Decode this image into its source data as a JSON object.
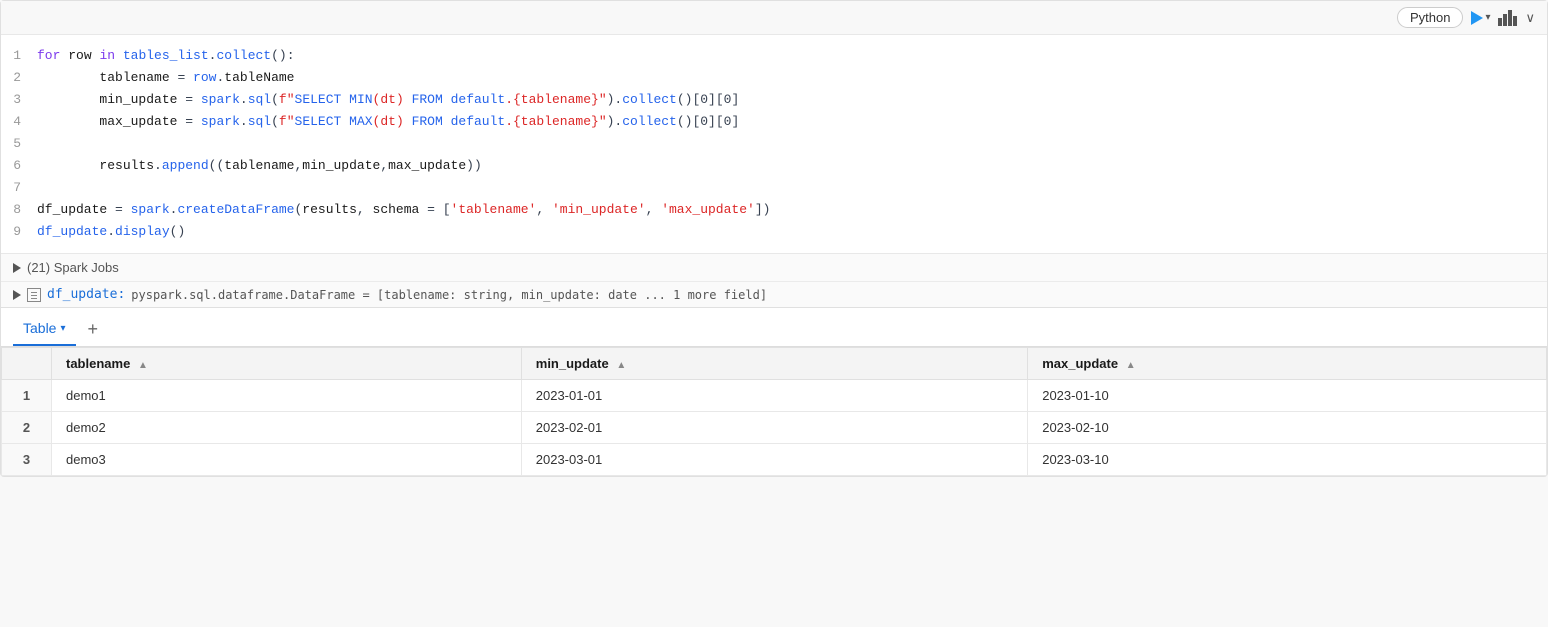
{
  "toolbar": {
    "language": "Python",
    "run_label": "Run",
    "expand_label": "∨"
  },
  "code": {
    "lines": [
      {
        "num": "1",
        "tokens": [
          {
            "t": "kw",
            "v": "for "
          },
          {
            "t": "var",
            "v": "row "
          },
          {
            "t": "kw",
            "v": "in "
          },
          {
            "t": "fn",
            "v": "tables_list"
          },
          {
            "t": "op",
            "v": "."
          },
          {
            "t": "fn",
            "v": "collect"
          },
          {
            "t": "op",
            "v": "():"
          }
        ]
      },
      {
        "num": "2",
        "tokens": [
          {
            "t": "var",
            "v": "        tablename "
          },
          {
            "t": "op",
            "v": "= "
          },
          {
            "t": "fn",
            "v": "row"
          },
          {
            "t": "op",
            "v": "."
          },
          {
            "t": "var",
            "v": "tableName"
          }
        ]
      },
      {
        "num": "3",
        "tokens": [
          {
            "t": "var",
            "v": "        min_update "
          },
          {
            "t": "op",
            "v": "= "
          },
          {
            "t": "fn",
            "v": "spark"
          },
          {
            "t": "op",
            "v": "."
          },
          {
            "t": "fn",
            "v": "sql"
          },
          {
            "t": "op",
            "v": "("
          },
          {
            "t": "fstr",
            "v": "f\"SELECT MIN(dt) FROM default.{tablename}\""
          },
          {
            "t": "op",
            "v": ")."
          },
          {
            "t": "fn",
            "v": "collect"
          },
          {
            "t": "op",
            "v": "()[0][0]"
          }
        ]
      },
      {
        "num": "4",
        "tokens": [
          {
            "t": "var",
            "v": "        max_update "
          },
          {
            "t": "op",
            "v": "= "
          },
          {
            "t": "fn",
            "v": "spark"
          },
          {
            "t": "op",
            "v": "."
          },
          {
            "t": "fn",
            "v": "sql"
          },
          {
            "t": "op",
            "v": "("
          },
          {
            "t": "fstr",
            "v": "f\"SELECT MAX(dt) FROM default.{tablename}\""
          },
          {
            "t": "op",
            "v": ")."
          },
          {
            "t": "fn",
            "v": "collect"
          },
          {
            "t": "op",
            "v": "()[0][0]"
          }
        ]
      },
      {
        "num": "5",
        "tokens": []
      },
      {
        "num": "6",
        "tokens": [
          {
            "t": "var",
            "v": "        results"
          },
          {
            "t": "op",
            "v": "."
          },
          {
            "t": "fn",
            "v": "append"
          },
          {
            "t": "op",
            "v": "(("
          },
          {
            "t": "var",
            "v": "tablename"
          },
          {
            "t": "op",
            "v": ","
          },
          {
            "t": "var",
            "v": "min_update"
          },
          {
            "t": "op",
            "v": ","
          },
          {
            "t": "var",
            "v": "max_update"
          },
          {
            "t": "op",
            "v": "))"
          }
        ]
      },
      {
        "num": "7",
        "tokens": []
      },
      {
        "num": "8",
        "tokens": [
          {
            "t": "var",
            "v": "df_update "
          },
          {
            "t": "op",
            "v": "= "
          },
          {
            "t": "fn",
            "v": "spark"
          },
          {
            "t": "op",
            "v": "."
          },
          {
            "t": "fn",
            "v": "createDataFrame"
          },
          {
            "t": "op",
            "v": "("
          },
          {
            "t": "var",
            "v": "results"
          },
          {
            "t": "op",
            "v": ", "
          },
          {
            "t": "var",
            "v": "schema "
          },
          {
            "t": "op",
            "v": "= ["
          },
          {
            "t": "str",
            "v": "'tablename'"
          },
          {
            "t": "op",
            "v": ", "
          },
          {
            "t": "str",
            "v": "'min_update'"
          },
          {
            "t": "op",
            "v": ", "
          },
          {
            "t": "str",
            "v": "'max_update'"
          },
          {
            "t": "op",
            "v": "'])"
          }
        ]
      },
      {
        "num": "9",
        "tokens": [
          {
            "t": "fn",
            "v": "df_update"
          },
          {
            "t": "op",
            "v": "."
          },
          {
            "t": "fn",
            "v": "display"
          },
          {
            "t": "op",
            "v": "()"
          }
        ]
      }
    ]
  },
  "output": {
    "spark_jobs": "(21) Spark Jobs",
    "df_info": "df_update: pyspark.sql.dataframe.DataFrame = [tablename: string, min_update: date ... 1 more field]",
    "df_label": "df_update:",
    "df_type": "pyspark.sql.dataframe.DataFrame = [tablename: string, min_update: date ... 1 more field]"
  },
  "table_view": {
    "tab_label": "Table",
    "add_label": "+",
    "columns": [
      {
        "key": "tablename",
        "label": "tablename"
      },
      {
        "key": "min_update",
        "label": "min_update"
      },
      {
        "key": "max_update",
        "label": "max_update"
      }
    ],
    "rows": [
      {
        "row_num": "1",
        "tablename": "demo1",
        "min_update": "2023-01-01",
        "max_update": "2023-01-10"
      },
      {
        "row_num": "2",
        "tablename": "demo2",
        "min_update": "2023-02-01",
        "max_update": "2023-02-10"
      },
      {
        "row_num": "3",
        "tablename": "demo3",
        "min_update": "2023-03-01",
        "max_update": "2023-03-10"
      }
    ]
  }
}
